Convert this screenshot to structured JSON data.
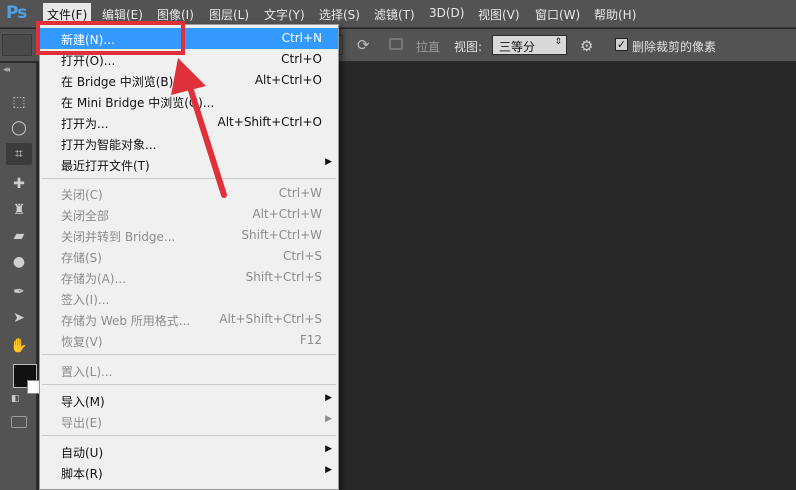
{
  "app": {
    "logo": "Ps",
    "accent_color": "#4fa0e6"
  },
  "menubar": {
    "items": [
      {
        "label": "文件(F)"
      },
      {
        "label": "编辑(E)"
      },
      {
        "label": "图像(I)"
      },
      {
        "label": "图层(L)"
      },
      {
        "label": "文字(Y)"
      },
      {
        "label": "选择(S)"
      },
      {
        "label": "滤镜(T)"
      },
      {
        "label": "3D(D)"
      },
      {
        "label": "视图(V)"
      },
      {
        "label": "窗口(W)"
      },
      {
        "label": "帮助(H)"
      }
    ]
  },
  "options_bar": {
    "straighten_label": "拉直",
    "view_label": "视图:",
    "view_value": "三等分",
    "delete_cropped_label": "删除裁剪的像素",
    "delete_cropped_checked": true
  },
  "file_menu": {
    "items": [
      {
        "label": "新建(N)...",
        "shortcut": "Ctrl+N",
        "state": "highlighted"
      },
      {
        "label": "打开(O)...",
        "shortcut": "Ctrl+O",
        "state": "enabled"
      },
      {
        "label": "在 Bridge 中浏览(B)...",
        "shortcut": "Alt+Ctrl+O",
        "state": "enabled"
      },
      {
        "label": "在 Mini Bridge 中浏览(G)...",
        "shortcut": "",
        "state": "enabled"
      },
      {
        "label": "打开为...",
        "shortcut": "Alt+Shift+Ctrl+O",
        "state": "enabled"
      },
      {
        "label": "打开为智能对象...",
        "shortcut": "",
        "state": "enabled"
      },
      {
        "label": "最近打开文件(T)",
        "shortcut": "",
        "state": "enabled",
        "submenu": true
      },
      {
        "label": "关闭(C)",
        "shortcut": "Ctrl+W",
        "state": "disabled"
      },
      {
        "label": "关闭全部",
        "shortcut": "Alt+Ctrl+W",
        "state": "disabled"
      },
      {
        "label": "关闭并转到 Bridge...",
        "shortcut": "Shift+Ctrl+W",
        "state": "disabled"
      },
      {
        "label": "存储(S)",
        "shortcut": "Ctrl+S",
        "state": "disabled"
      },
      {
        "label": "存储为(A)...",
        "shortcut": "Shift+Ctrl+S",
        "state": "disabled"
      },
      {
        "label": "签入(I)...",
        "shortcut": "",
        "state": "disabled"
      },
      {
        "label": "存储为 Web 所用格式...",
        "shortcut": "Alt+Shift+Ctrl+S",
        "state": "disabled"
      },
      {
        "label": "恢复(V)",
        "shortcut": "F12",
        "state": "disabled"
      },
      {
        "label": "置入(L)...",
        "shortcut": "",
        "state": "disabled"
      },
      {
        "label": "导入(M)",
        "shortcut": "",
        "state": "enabled",
        "submenu": true
      },
      {
        "label": "导出(E)",
        "shortcut": "",
        "state": "disabled",
        "submenu": true
      },
      {
        "label": "自动(U)",
        "shortcut": "",
        "state": "enabled",
        "submenu": true
      },
      {
        "label": "脚本(R)",
        "shortcut": "",
        "state": "enabled",
        "submenu": true
      }
    ],
    "submenu_glyph": "▶"
  },
  "annotation": {
    "color": "#e0303a"
  }
}
